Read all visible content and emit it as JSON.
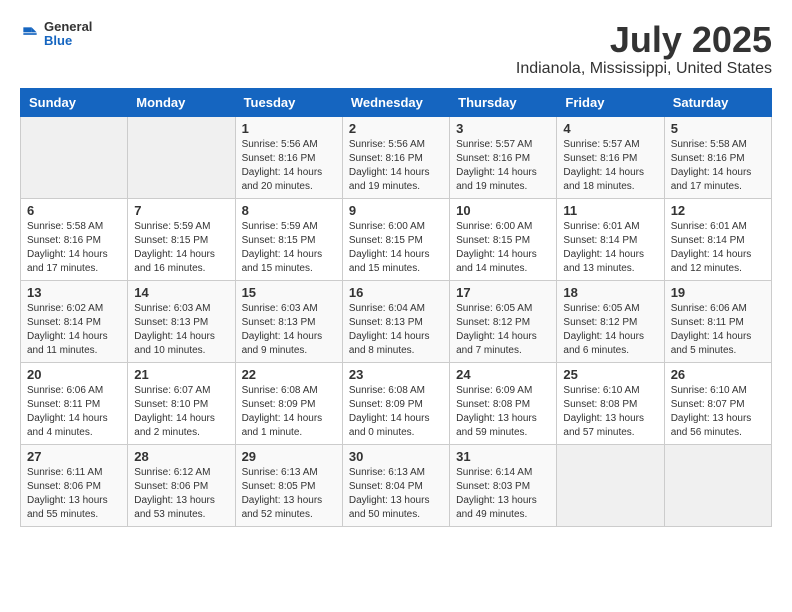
{
  "logo": {
    "line1": "General",
    "line2": "Blue"
  },
  "title": "July 2025",
  "subtitle": "Indianola, Mississippi, United States",
  "days_of_week": [
    "Sunday",
    "Monday",
    "Tuesday",
    "Wednesday",
    "Thursday",
    "Friday",
    "Saturday"
  ],
  "weeks": [
    [
      {
        "day": "",
        "info": ""
      },
      {
        "day": "",
        "info": ""
      },
      {
        "day": "1",
        "info": "Sunrise: 5:56 AM\nSunset: 8:16 PM\nDaylight: 14 hours and 20 minutes."
      },
      {
        "day": "2",
        "info": "Sunrise: 5:56 AM\nSunset: 8:16 PM\nDaylight: 14 hours and 19 minutes."
      },
      {
        "day": "3",
        "info": "Sunrise: 5:57 AM\nSunset: 8:16 PM\nDaylight: 14 hours and 19 minutes."
      },
      {
        "day": "4",
        "info": "Sunrise: 5:57 AM\nSunset: 8:16 PM\nDaylight: 14 hours and 18 minutes."
      },
      {
        "day": "5",
        "info": "Sunrise: 5:58 AM\nSunset: 8:16 PM\nDaylight: 14 hours and 17 minutes."
      }
    ],
    [
      {
        "day": "6",
        "info": "Sunrise: 5:58 AM\nSunset: 8:16 PM\nDaylight: 14 hours and 17 minutes."
      },
      {
        "day": "7",
        "info": "Sunrise: 5:59 AM\nSunset: 8:15 PM\nDaylight: 14 hours and 16 minutes."
      },
      {
        "day": "8",
        "info": "Sunrise: 5:59 AM\nSunset: 8:15 PM\nDaylight: 14 hours and 15 minutes."
      },
      {
        "day": "9",
        "info": "Sunrise: 6:00 AM\nSunset: 8:15 PM\nDaylight: 14 hours and 15 minutes."
      },
      {
        "day": "10",
        "info": "Sunrise: 6:00 AM\nSunset: 8:15 PM\nDaylight: 14 hours and 14 minutes."
      },
      {
        "day": "11",
        "info": "Sunrise: 6:01 AM\nSunset: 8:14 PM\nDaylight: 14 hours and 13 minutes."
      },
      {
        "day": "12",
        "info": "Sunrise: 6:01 AM\nSunset: 8:14 PM\nDaylight: 14 hours and 12 minutes."
      }
    ],
    [
      {
        "day": "13",
        "info": "Sunrise: 6:02 AM\nSunset: 8:14 PM\nDaylight: 14 hours and 11 minutes."
      },
      {
        "day": "14",
        "info": "Sunrise: 6:03 AM\nSunset: 8:13 PM\nDaylight: 14 hours and 10 minutes."
      },
      {
        "day": "15",
        "info": "Sunrise: 6:03 AM\nSunset: 8:13 PM\nDaylight: 14 hours and 9 minutes."
      },
      {
        "day": "16",
        "info": "Sunrise: 6:04 AM\nSunset: 8:13 PM\nDaylight: 14 hours and 8 minutes."
      },
      {
        "day": "17",
        "info": "Sunrise: 6:05 AM\nSunset: 8:12 PM\nDaylight: 14 hours and 7 minutes."
      },
      {
        "day": "18",
        "info": "Sunrise: 6:05 AM\nSunset: 8:12 PM\nDaylight: 14 hours and 6 minutes."
      },
      {
        "day": "19",
        "info": "Sunrise: 6:06 AM\nSunset: 8:11 PM\nDaylight: 14 hours and 5 minutes."
      }
    ],
    [
      {
        "day": "20",
        "info": "Sunrise: 6:06 AM\nSunset: 8:11 PM\nDaylight: 14 hours and 4 minutes."
      },
      {
        "day": "21",
        "info": "Sunrise: 6:07 AM\nSunset: 8:10 PM\nDaylight: 14 hours and 2 minutes."
      },
      {
        "day": "22",
        "info": "Sunrise: 6:08 AM\nSunset: 8:09 PM\nDaylight: 14 hours and 1 minute."
      },
      {
        "day": "23",
        "info": "Sunrise: 6:08 AM\nSunset: 8:09 PM\nDaylight: 14 hours and 0 minutes."
      },
      {
        "day": "24",
        "info": "Sunrise: 6:09 AM\nSunset: 8:08 PM\nDaylight: 13 hours and 59 minutes."
      },
      {
        "day": "25",
        "info": "Sunrise: 6:10 AM\nSunset: 8:08 PM\nDaylight: 13 hours and 57 minutes."
      },
      {
        "day": "26",
        "info": "Sunrise: 6:10 AM\nSunset: 8:07 PM\nDaylight: 13 hours and 56 minutes."
      }
    ],
    [
      {
        "day": "27",
        "info": "Sunrise: 6:11 AM\nSunset: 8:06 PM\nDaylight: 13 hours and 55 minutes."
      },
      {
        "day": "28",
        "info": "Sunrise: 6:12 AM\nSunset: 8:06 PM\nDaylight: 13 hours and 53 minutes."
      },
      {
        "day": "29",
        "info": "Sunrise: 6:13 AM\nSunset: 8:05 PM\nDaylight: 13 hours and 52 minutes."
      },
      {
        "day": "30",
        "info": "Sunrise: 6:13 AM\nSunset: 8:04 PM\nDaylight: 13 hours and 50 minutes."
      },
      {
        "day": "31",
        "info": "Sunrise: 6:14 AM\nSunset: 8:03 PM\nDaylight: 13 hours and 49 minutes."
      },
      {
        "day": "",
        "info": ""
      },
      {
        "day": "",
        "info": ""
      }
    ]
  ]
}
